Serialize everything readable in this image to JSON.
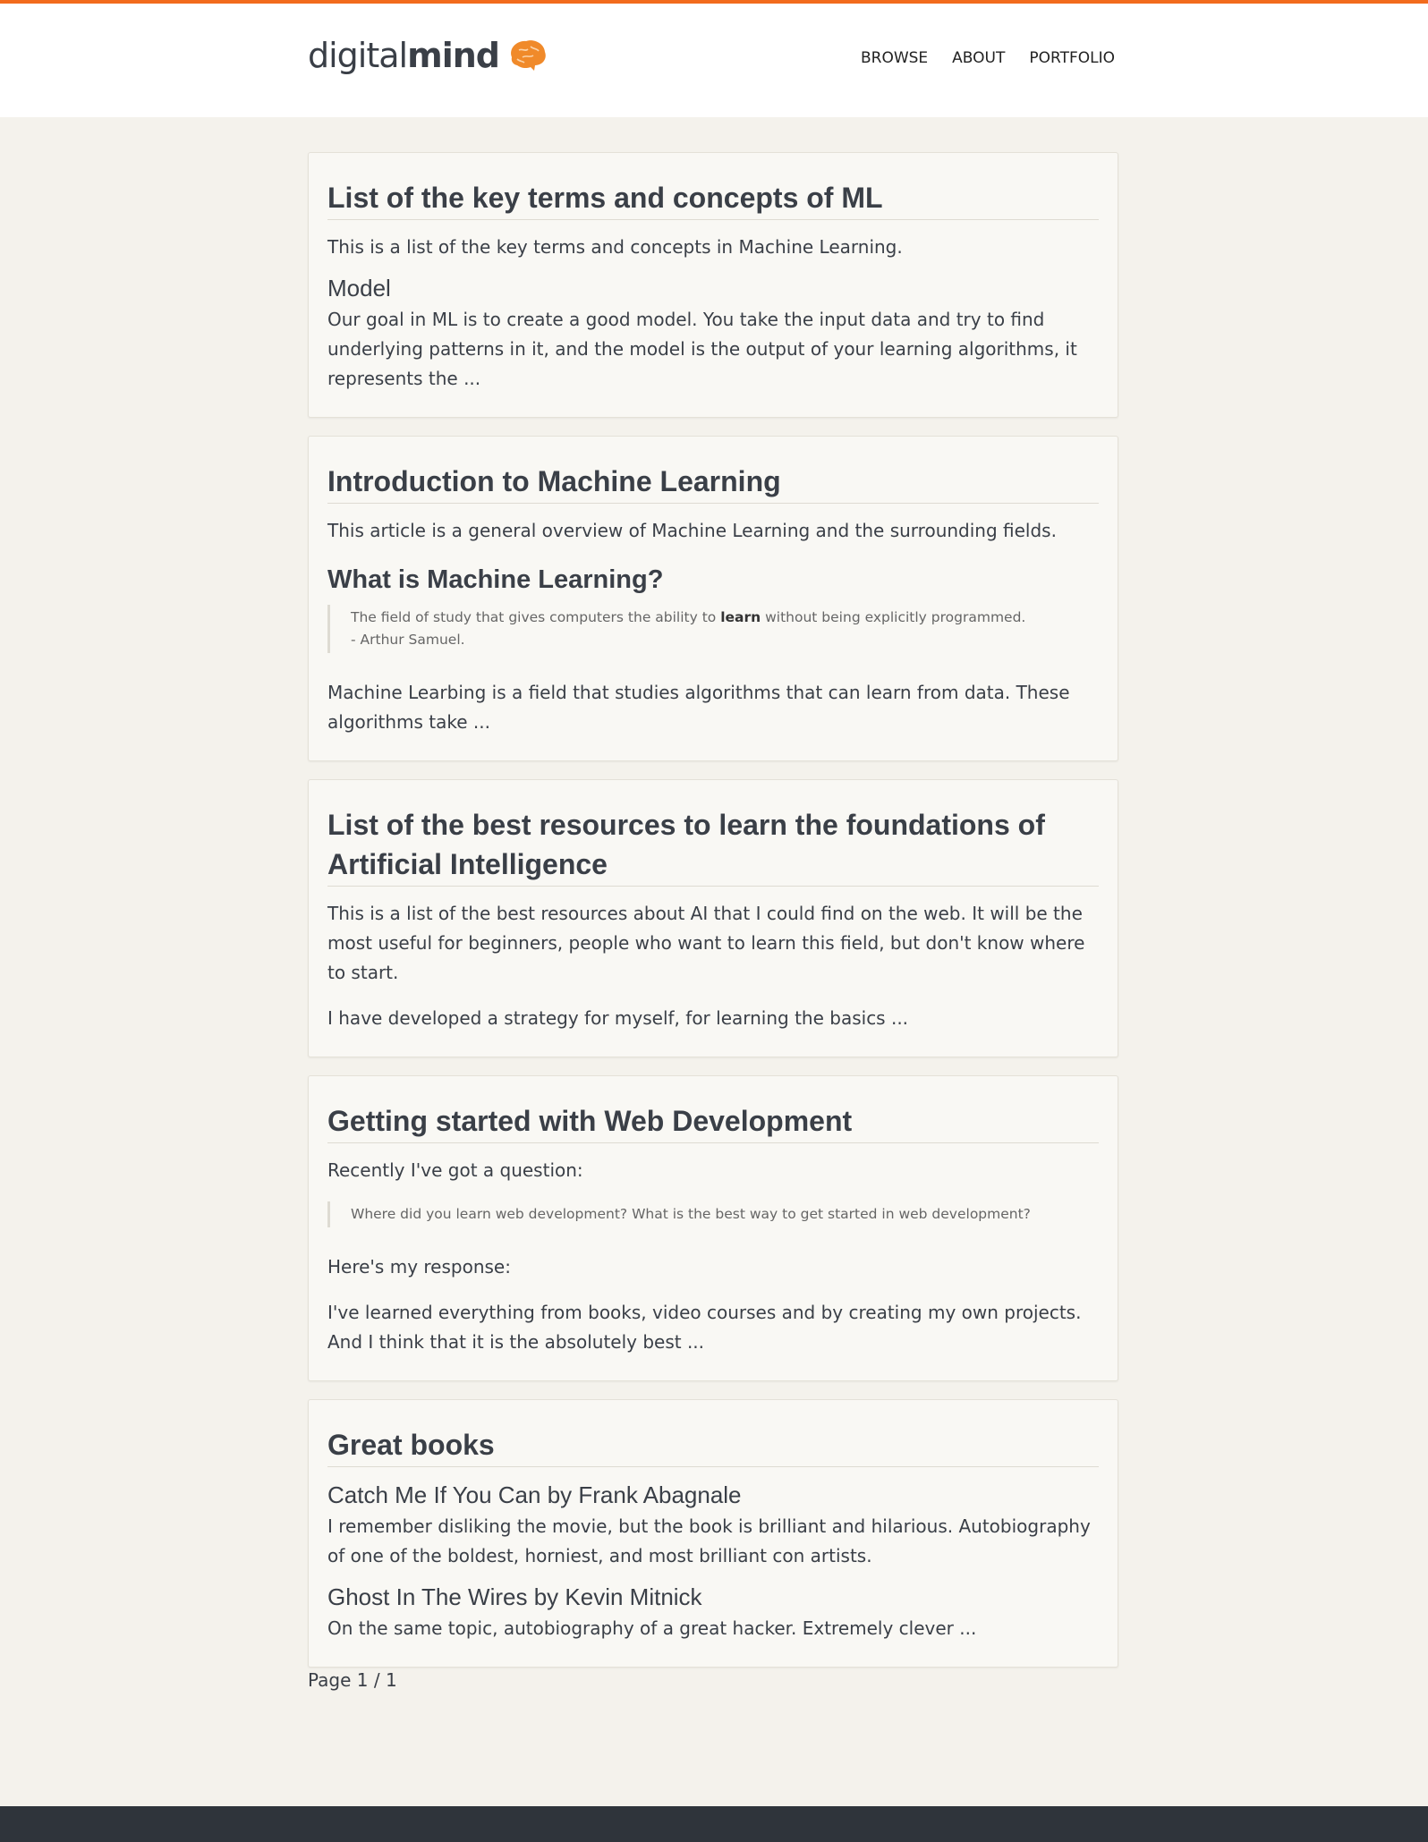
{
  "header": {
    "logo_light": "digital",
    "logo_bold": "mind",
    "logo_icon": "brain-icon",
    "nav": [
      {
        "label": "BROWSE"
      },
      {
        "label": "ABOUT"
      },
      {
        "label": "PORTFOLIO"
      }
    ]
  },
  "posts": [
    {
      "title": "List of the key terms and concepts of ML",
      "intro": "This is a list of the key terms and concepts in Machine Learning.",
      "subheading": "Model",
      "excerpt": "Our goal in ML is to create a good model. You take the input data and try to find underlying patterns in it, and the model is the output of your learning algorithms, it represents the ..."
    },
    {
      "title": "Introduction to Machine Learning",
      "intro": "This article is a general overview of Machine Learning and the surrounding fields.",
      "subheading": "What is Machine Learning?",
      "quote_before": "The field of study that gives computers the ability to ",
      "quote_bold": "learn",
      "quote_after": " without being explicitly programmed.",
      "quote_author": "- Arthur Samuel.",
      "excerpt": "Machine Learbing is a field that studies algorithms that can learn from data. These algorithms take ..."
    },
    {
      "title": "List of the best resources to learn the foundations of Artificial Intelligence",
      "intro": "This is a list of the best resources about AI that I could find on the web. It will be the most useful for beginners, people who want to learn this field, but don't know where to start.",
      "excerpt": "I have developed a strategy for myself, for learning the basics ..."
    },
    {
      "title": "Getting started with Web Development",
      "intro": "Recently I've got a question:",
      "quote": "Where did you learn web development? What is the best way to get started in web development?",
      "response": "Here's my response:",
      "excerpt": "I've learned everything from books, video courses and by creating my own projects. And I think that it is the absolutely best ..."
    },
    {
      "title": "Great books",
      "book1_title": "Catch Me If You Can by Frank Abagnale",
      "book1_text": "I remember disliking the movie, but the book is brilliant and hilarious. Autobiography of one of the boldest, horniest, and most brilliant con artists.",
      "book2_title": "Ghost In The Wires by Kevin Mitnick",
      "book2_text": "On the same topic, autobiography of a great hacker. Extremely clever ..."
    }
  ],
  "pagination": "Page 1 / 1",
  "colors": {
    "accent": "#f26b1d",
    "background": "#f4f2ec",
    "card": "#f9f8f4",
    "text": "#3a3f47",
    "footer": "#2f343b"
  }
}
